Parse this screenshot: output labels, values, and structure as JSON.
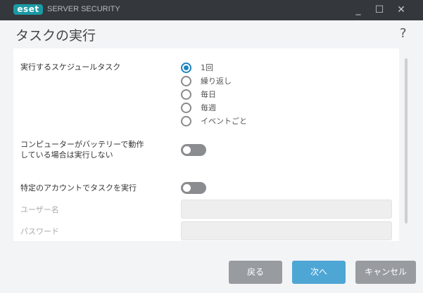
{
  "titlebar": {
    "logo": "eset",
    "product": "SERVER SECURITY",
    "minimize": "_",
    "maximize": "☐",
    "close": "✕"
  },
  "page": {
    "title": "タスクの実行",
    "help": "?"
  },
  "form": {
    "schedule_label": "実行するスケジュールタスク",
    "options": [
      "1回",
      "繰り返し",
      "毎日",
      "毎週",
      "イベントごと"
    ],
    "selected": "1回",
    "battery_label_1": "コンピューターがバッテリーで動作",
    "battery_label_2": "している場合は実行しない",
    "battery_toggle": false,
    "account_label": "特定のアカウントでタスクを実行",
    "account_toggle": false,
    "username_label": "ユーザー名",
    "username_value": "",
    "password_label": "パスワード",
    "password_value": ""
  },
  "buttons": {
    "back": "戻る",
    "next": "次へ",
    "cancel": "キャンセル"
  }
}
